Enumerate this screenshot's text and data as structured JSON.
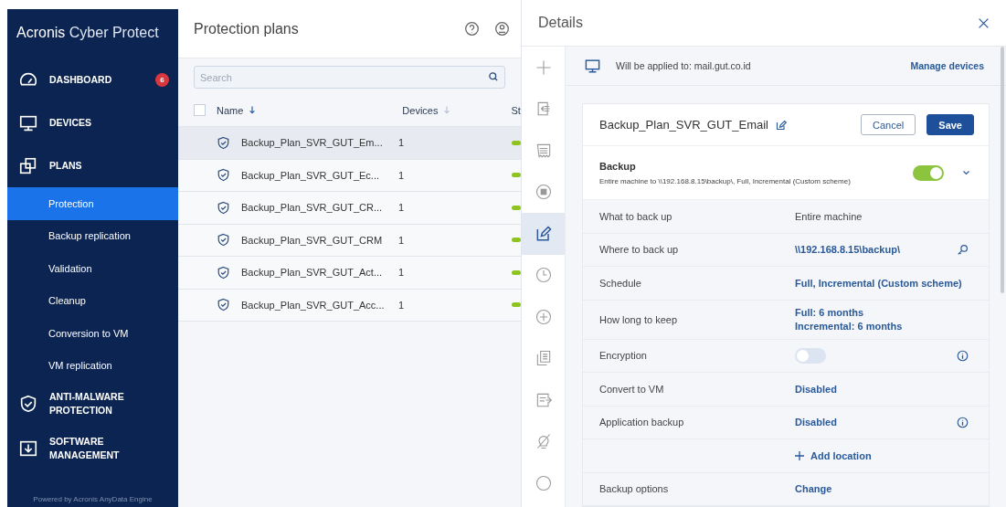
{
  "sidebar": {
    "brand": "Acronis",
    "product": "Cyber Protect",
    "items": [
      {
        "label": "DASHBOARD",
        "badge": "6",
        "selected": false
      },
      {
        "label": "DEVICES",
        "selected": false
      },
      {
        "label": "PLANS",
        "selected": false,
        "children": [
          {
            "label": "Protection",
            "selected": true
          },
          {
            "label": "Backup replication",
            "selected": false
          },
          {
            "label": "Validation",
            "selected": false
          },
          {
            "label": "Cleanup",
            "selected": false
          },
          {
            "label": "Conversion to VM",
            "selected": false
          },
          {
            "label": "VM replication",
            "selected": false
          }
        ]
      },
      {
        "label": "ANTI-MALWARE PROTECTION",
        "selected": false
      },
      {
        "label": "SOFTWARE MANAGEMENT",
        "selected": false
      }
    ],
    "footer": "Powered by Acronis AnyData Engine"
  },
  "plans": {
    "title": "Protection plans",
    "search": {
      "placeholder": "Search"
    },
    "columns": [
      "Name",
      "Devices",
      "St"
    ],
    "select_all": {
      "checked": false
    },
    "rows": [
      {
        "name": "Backup_Plan_SVR_GUT_Em...",
        "devices": "1",
        "selected": true
      },
      {
        "name": "Backup_Plan_SVR_GUT_Ec...",
        "devices": "1",
        "selected": false
      },
      {
        "name": "Backup_Plan_SVR_GUT_CR...",
        "devices": "1",
        "selected": false
      },
      {
        "name": "Backup_Plan_SVR_GUT_CRM",
        "devices": "1",
        "selected": false
      },
      {
        "name": "Backup_Plan_SVR_GUT_Act...",
        "devices": "1",
        "selected": false
      },
      {
        "name": "Backup_Plan_SVR_GUT_Acc...",
        "devices": "1",
        "selected": false
      }
    ]
  },
  "details": {
    "title": "Details",
    "tools": [
      {
        "selected": false
      },
      {
        "selected": false
      },
      {
        "selected": false
      },
      {
        "selected": false
      },
      {
        "selected": true
      },
      {
        "selected": false
      },
      {
        "selected": false
      },
      {
        "selected": false
      },
      {
        "selected": false
      },
      {
        "selected": false
      },
      {
        "selected": false
      }
    ],
    "applied_to": "Will be applied to: mail.gut.co.id",
    "manage": "Manage devices",
    "plan_name": "Backup_Plan_SVR_GUT_Email",
    "cancel": "Cancel",
    "save": "Save",
    "section": {
      "title": "Backup",
      "summary": "Entire machine to \\\\192.168.8.15\\backup\\, Full, Incremental (Custom scheme)",
      "on": true
    },
    "rows": [
      {
        "kind": "text",
        "label": "What to back up",
        "value": "Entire machine"
      },
      {
        "kind": "link",
        "label": "Where to back up",
        "value": "\\\\192.168.8.15\\backup\\",
        "has_key": true
      },
      {
        "kind": "link",
        "label": "Schedule",
        "value": "Full, Incremental (Custom scheme)"
      },
      {
        "kind": "lines",
        "label": "How long to keep",
        "values": [
          "Full: 6 months",
          "Incremental: 6 months"
        ]
      },
      {
        "kind": "toggle",
        "label": "Encryption",
        "on": false,
        "has_info": true
      },
      {
        "kind": "link",
        "label": "Convert to VM",
        "value": "Disabled"
      },
      {
        "kind": "link",
        "label": "Application backup",
        "value": "Disabled",
        "has_info": true
      },
      {
        "kind": "add",
        "value": "Add location"
      },
      {
        "kind": "link",
        "label": "Backup options",
        "value": "Change"
      }
    ]
  }
}
